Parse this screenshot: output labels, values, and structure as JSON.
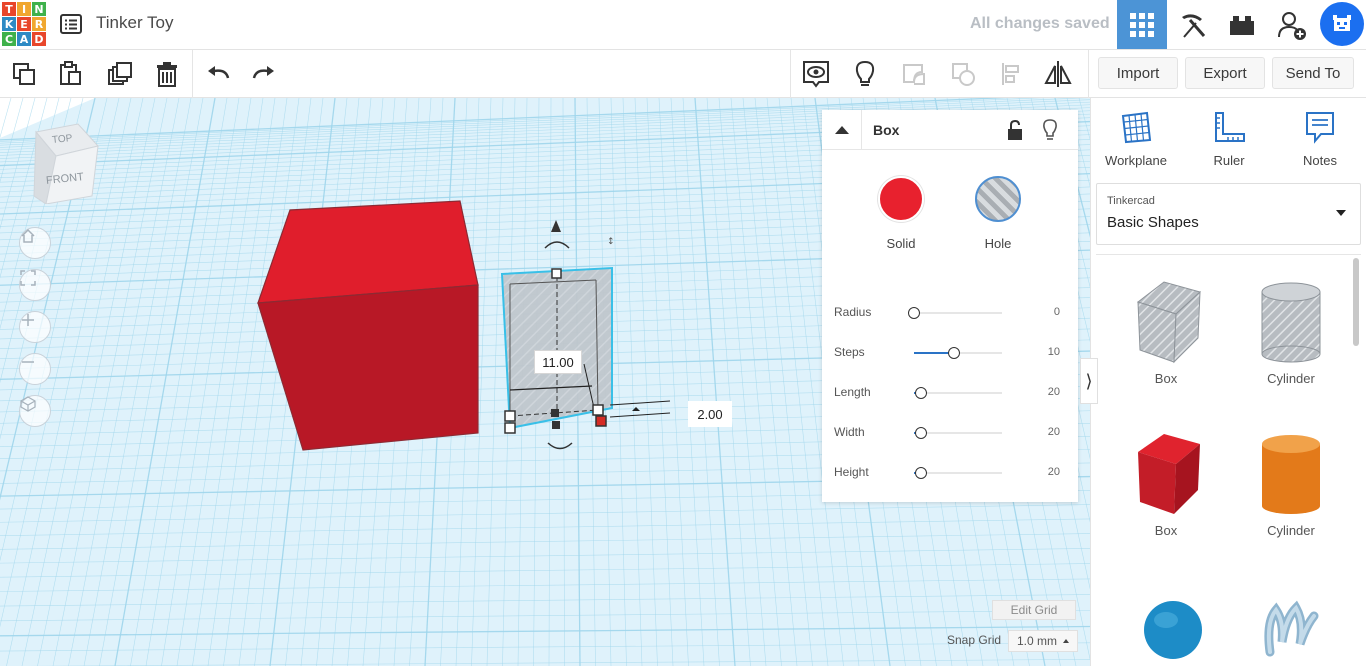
{
  "app": {
    "logo_letters": [
      "T",
      "I",
      "N",
      "K",
      "E",
      "R",
      "C",
      "A",
      "D"
    ],
    "logo_colors": [
      "#e8462b",
      "#f0a72f",
      "#3fb14b",
      "#2d8ac4",
      "#e8462b",
      "#f0a72f",
      "#3fb14b",
      "#2d8ac4",
      "#e8462b"
    ],
    "design_title": "Tinker Toy",
    "save_status": "All changes saved"
  },
  "header": {
    "buttons": [
      {
        "name": "3d-design-view",
        "icon": "grid-icon",
        "active": true
      },
      {
        "name": "codeblocks",
        "icon": "pickaxe-icon",
        "active": false
      },
      {
        "name": "bricks",
        "icon": "brick-icon",
        "active": false
      },
      {
        "name": "invite-people",
        "icon": "add-user-icon",
        "active": false
      }
    ]
  },
  "toolbar": {
    "left_tools": [
      "copy-icon",
      "paste-icon",
      "duplicate-icon",
      "delete-icon",
      "undo-icon",
      "redo-icon"
    ],
    "right_tools": [
      "show-all-icon",
      "hint-bulb-icon",
      "group-icon",
      "ungroup-icon",
      "align-icon",
      "mirror-icon"
    ],
    "import_label": "Import",
    "export_label": "Export",
    "send_to_label": "Send To"
  },
  "viewcube": {
    "top": "TOP",
    "front": "FRONT"
  },
  "viewport": {
    "nav": [
      "home-view-icon",
      "fit-all-icon",
      "zoom-in-icon",
      "zoom-out-icon",
      "perspective-icon"
    ],
    "dimension_width": "11.00",
    "dimension_elevation": "2.00",
    "edit_grid_label": "Edit Grid",
    "snap_grid_label": "Snap Grid",
    "snap_grid_value": "1.0 mm"
  },
  "inspector": {
    "title": "Box",
    "solid_label": "Solid",
    "hole_label": "Hole",
    "solid_color": "#e8212e",
    "properties": [
      {
        "name": "Radius",
        "value": "0",
        "fraction": 0.0
      },
      {
        "name": "Steps",
        "value": "10",
        "fraction": 0.45
      },
      {
        "name": "Length",
        "value": "20",
        "fraction": 0.08
      },
      {
        "name": "Width",
        "value": "20",
        "fraction": 0.08
      },
      {
        "name": "Height",
        "value": "20",
        "fraction": 0.08
      }
    ]
  },
  "sidebar": {
    "tools": [
      {
        "label": "Workplane",
        "icon": "workplane-icon"
      },
      {
        "label": "Ruler",
        "icon": "ruler-icon"
      },
      {
        "label": "Notes",
        "icon": "notes-icon"
      }
    ],
    "library_source": "Tinkercad",
    "library_name": "Basic Shapes",
    "shapes": [
      {
        "label": "Box",
        "kind": "box-hole-icon"
      },
      {
        "label": "Cylinder",
        "kind": "cylinder-hole-icon"
      },
      {
        "label": "Box",
        "kind": "box-solid-icon"
      },
      {
        "label": "Cylinder",
        "kind": "cylinder-solid-icon"
      },
      {
        "label": "",
        "kind": "sphere-icon"
      },
      {
        "label": "",
        "kind": "scribble-icon"
      }
    ]
  },
  "colors": {
    "accent": "#4c94d6",
    "grid_line": "#9fd6ec",
    "red_box": "#e01e2c",
    "hole_box": "#bfc6cc"
  }
}
